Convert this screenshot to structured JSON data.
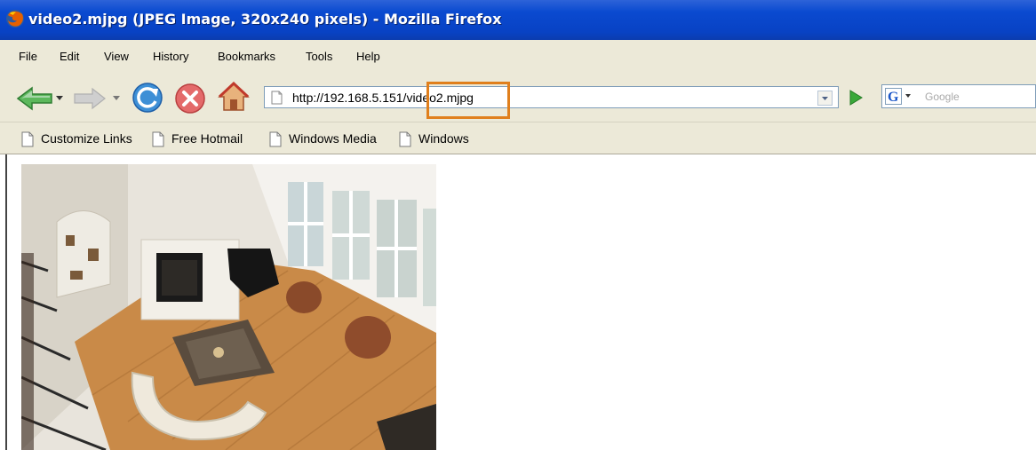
{
  "window": {
    "title": "video2.mjpg (JPEG Image, 320x240 pixels) - Mozilla Firefox"
  },
  "menu": {
    "items": [
      "File",
      "Edit",
      "View",
      "History",
      "Bookmarks",
      "Tools",
      "Help"
    ]
  },
  "navigation": {
    "url": "http://192.168.5.151/video2.mjpg",
    "highlighted_text": "video2.mjpg",
    "highlight_color": "#e07f1c",
    "search_placeholder": "Google"
  },
  "bookmarks": {
    "items": [
      "Customize Links",
      "Free Hotmail",
      "Windows Media",
      "Windows"
    ]
  },
  "content": {
    "image_subject": "living-room-camera-snapshot"
  },
  "colors": {
    "titlebar": "#0a4ad0",
    "chrome": "#ece9d8"
  }
}
